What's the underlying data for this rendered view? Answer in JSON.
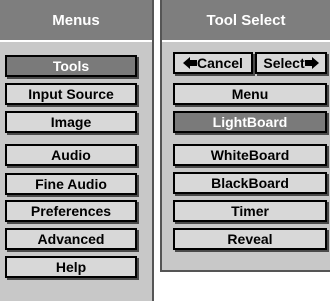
{
  "menus_panel": {
    "title": "Menus",
    "items": [
      {
        "label": "Tools",
        "active": true
      },
      {
        "label": "Input Source",
        "active": false
      },
      {
        "label": "Image",
        "active": false
      },
      {
        "label": "Audio",
        "active": false
      },
      {
        "label": "Fine Audio",
        "active": false
      },
      {
        "label": "Preferences",
        "active": false
      },
      {
        "label": "Advanced",
        "active": false
      },
      {
        "label": "Help",
        "active": false
      }
    ]
  },
  "tool_select_panel": {
    "title": "Tool Select",
    "cancel_label": "Cancel",
    "select_label": "Select",
    "cancel_icon": "left-arrow-icon",
    "select_icon": "right-arrow-icon",
    "items": [
      {
        "label": "Menu",
        "active": false
      },
      {
        "label": "LightBoard",
        "active": true
      },
      {
        "label": "WhiteBoard",
        "active": false
      },
      {
        "label": "BlackBoard",
        "active": false
      },
      {
        "label": "Timer",
        "active": false
      },
      {
        "label": "Reveal",
        "active": false
      }
    ]
  },
  "colors": {
    "panel_bg": "#c8c8c8",
    "header_bg": "#7e7e7e",
    "button_bg": "#d8d8d8",
    "active_bg": "#7a7a7a",
    "border": "#000000"
  }
}
